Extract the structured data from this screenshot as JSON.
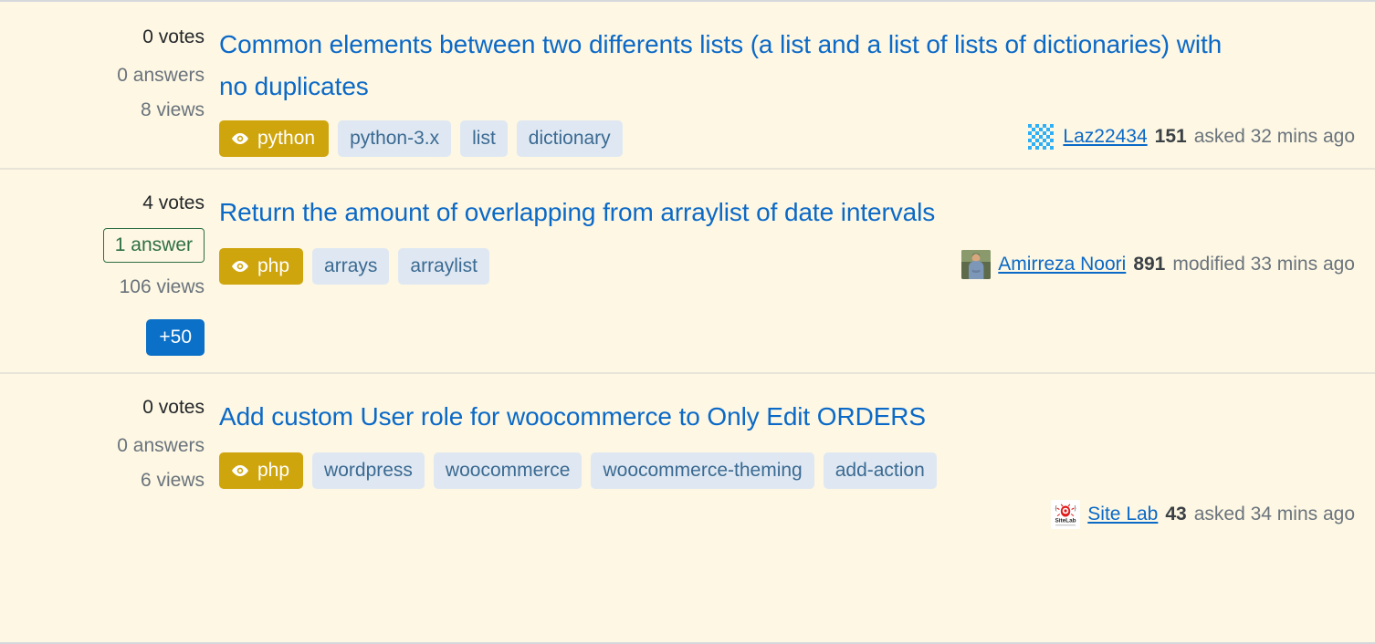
{
  "colors": {
    "page_background": "#fdf7e3",
    "title_link": "#0b69c7",
    "watched_tag_background": "#cfa50e",
    "tag_background": "#dfe8f2",
    "tag_text": "#3b6a92",
    "answered_accent": "#2f6f44",
    "bounty_background": "#0a70c8",
    "muted_text": "#6a737c",
    "divider": "#e8e4d8"
  },
  "questions": [
    {
      "votes": "0 votes",
      "answers": "0 answers",
      "answers_accepted": false,
      "views": "8 views",
      "bounty": null,
      "title": "Common elements between two differents lists (a list and a list of lists of dictionaries) with no duplicates",
      "tags": [
        {
          "label": "python",
          "watched": true,
          "icon": "eye-icon"
        },
        {
          "label": "python-3.x",
          "watched": false
        },
        {
          "label": "list",
          "watched": false
        },
        {
          "label": "dictionary",
          "watched": false
        }
      ],
      "user": {
        "avatar": "identicon-avatar",
        "name": "Laz22434",
        "reputation": "151",
        "action": "asked 32 mins ago"
      },
      "user_inline_with_tags": true
    },
    {
      "votes": "4 votes",
      "answers": "1 answer",
      "answers_accepted": true,
      "views": "106 views",
      "bounty": "+50",
      "title": "Return the amount of overlapping from arraylist of date intervals",
      "tags": [
        {
          "label": "php",
          "watched": true,
          "icon": "eye-icon"
        },
        {
          "label": "arrays",
          "watched": false
        },
        {
          "label": "arraylist",
          "watched": false
        }
      ],
      "user": {
        "avatar": "photo-avatar",
        "name": "Amirreza Noori",
        "reputation": "891",
        "action": "modified 33 mins ago"
      },
      "user_inline_with_tags": true
    },
    {
      "votes": "0 votes",
      "answers": "0 answers",
      "answers_accepted": false,
      "views": "6 views",
      "bounty": null,
      "title": "Add custom User role for woocommerce to Only Edit ORDERS",
      "tags": [
        {
          "label": "php",
          "watched": true,
          "icon": "eye-icon"
        },
        {
          "label": "wordpress",
          "watched": false
        },
        {
          "label": "woocommerce",
          "watched": false
        },
        {
          "label": "woocommerce-theming",
          "watched": false
        },
        {
          "label": "add-action",
          "watched": false
        }
      ],
      "user": {
        "avatar": "sitelab-logo-avatar",
        "name": "Site Lab",
        "reputation": "43",
        "action": "asked 34 mins ago"
      },
      "user_inline_with_tags": false
    }
  ]
}
